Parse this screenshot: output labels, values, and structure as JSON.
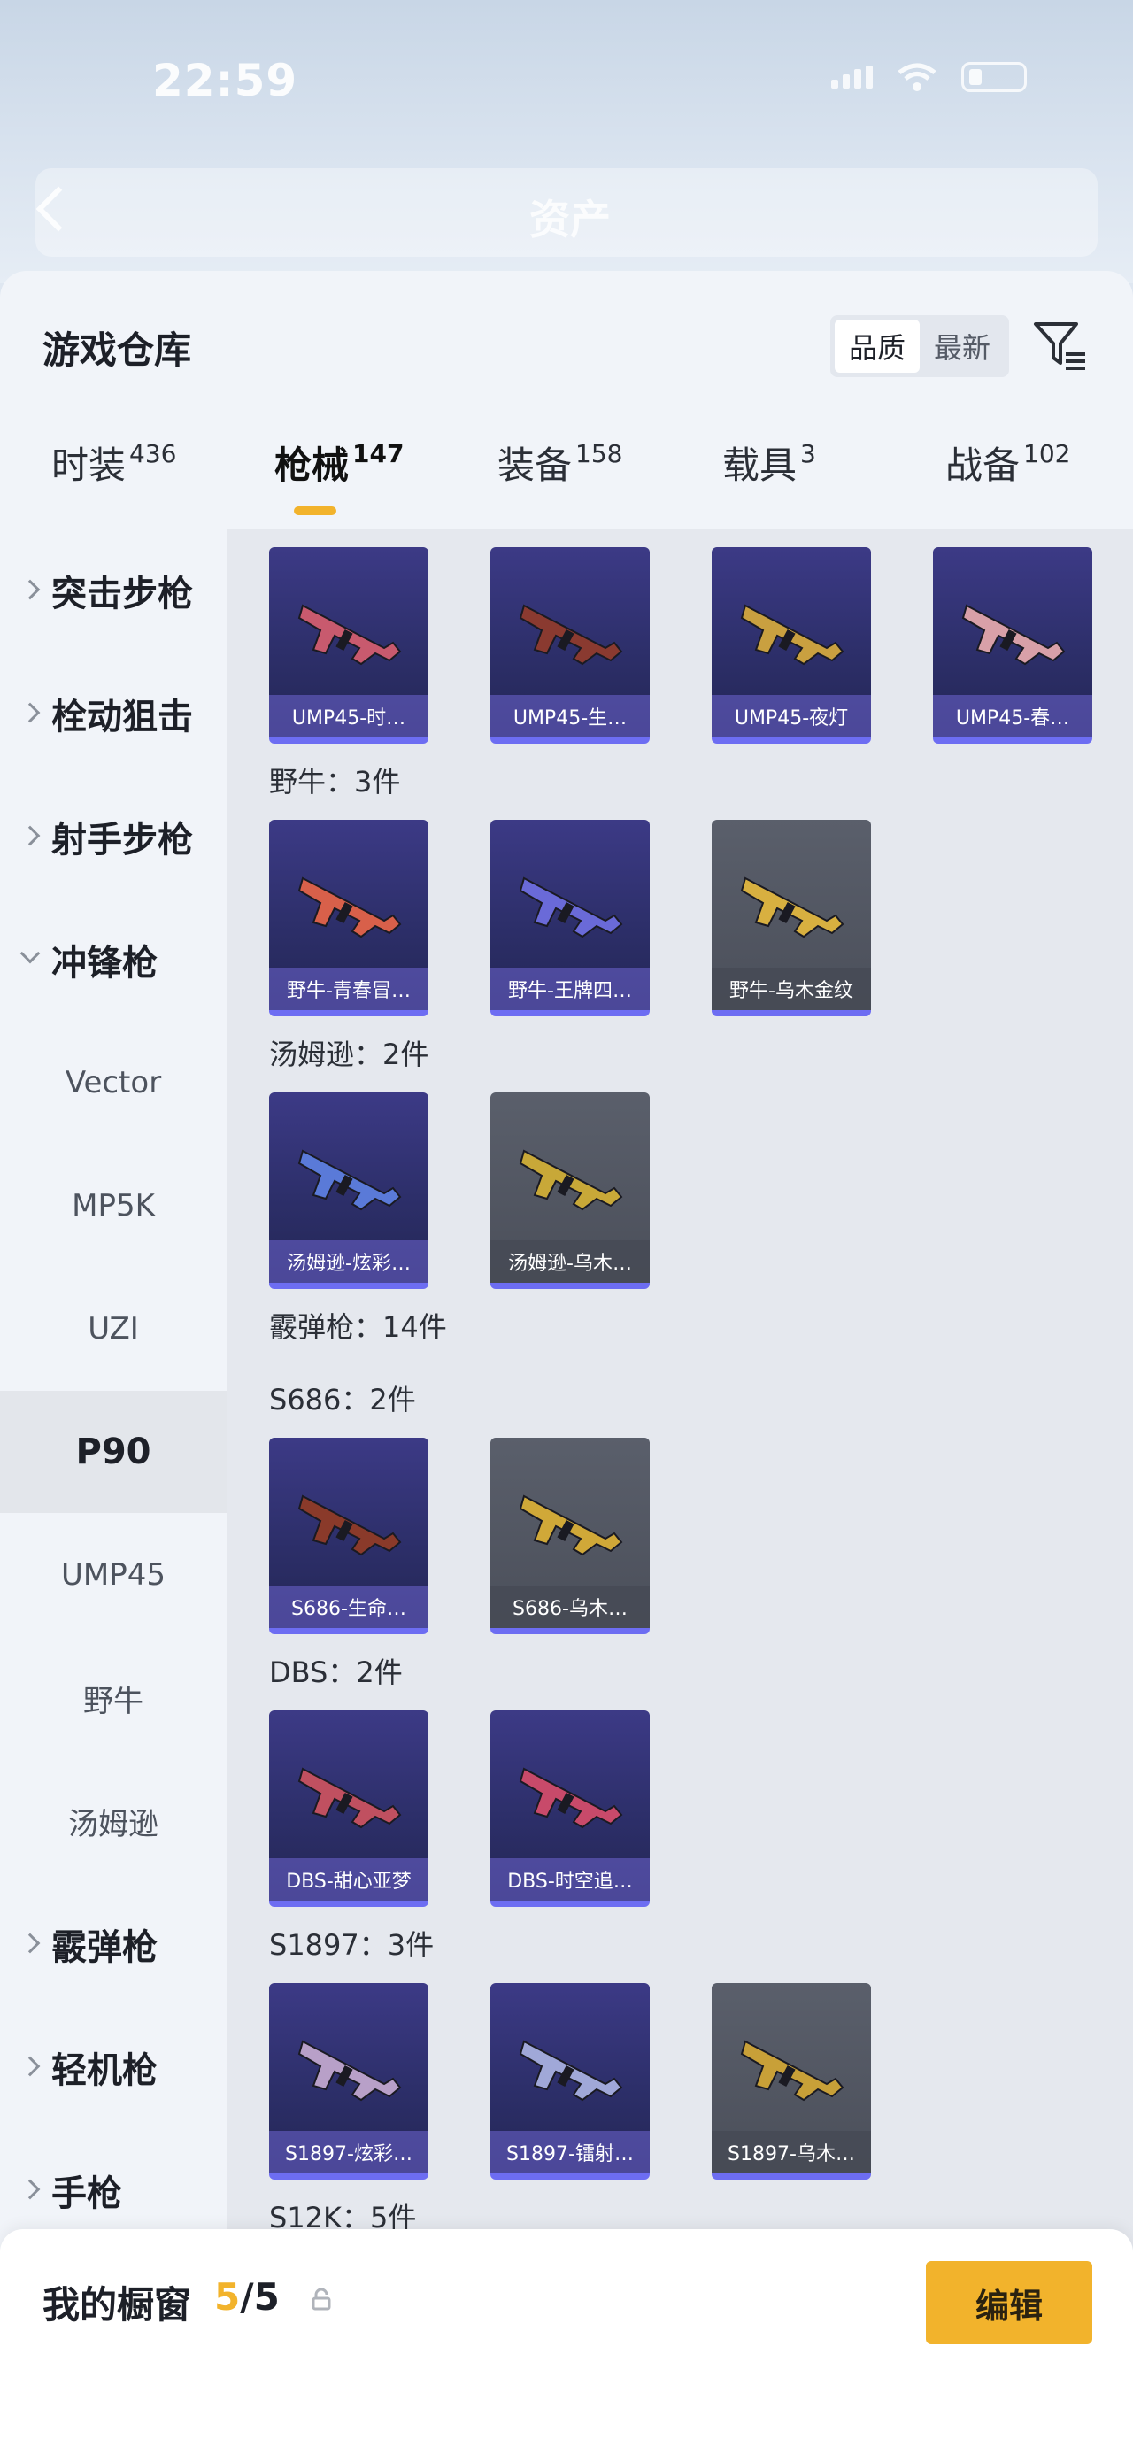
{
  "status_bar": {
    "time": "22:59"
  },
  "nav": {
    "title": "资产"
  },
  "sheet": {
    "title": "游戏仓库",
    "sort_options": [
      "品质",
      "最新"
    ],
    "tabs": [
      {
        "label": "时装",
        "count": "436"
      },
      {
        "label": "枪械",
        "count": "147"
      },
      {
        "label": "装备",
        "count": "158"
      },
      {
        "label": "载具",
        "count": "3"
      },
      {
        "label": "战备",
        "count": "102"
      }
    ]
  },
  "sidebar": {
    "items": [
      {
        "label": "突击步枪"
      },
      {
        "label": "栓动狙击"
      },
      {
        "label": "射手步枪"
      },
      {
        "label": "冲锋枪"
      },
      {
        "label": "Vector"
      },
      {
        "label": "MP5K"
      },
      {
        "label": "UZI"
      },
      {
        "label": "P90"
      },
      {
        "label": "UMP45"
      },
      {
        "label": "野牛"
      },
      {
        "label": "汤姆逊"
      },
      {
        "label": "霰弹枪"
      },
      {
        "label": "轻机枪"
      },
      {
        "label": "手枪"
      }
    ]
  },
  "content": {
    "groups": [
      {
        "title": "野牛：3件"
      },
      {
        "title": "汤姆逊：2件"
      },
      {
        "title": "霰弹枪：14件"
      },
      {
        "title": "S686：2件"
      },
      {
        "title": "DBS：2件"
      },
      {
        "title": "S1897：3件"
      },
      {
        "title": "S12K：5件"
      }
    ],
    "cards": [
      {
        "label": "UMP45-时…",
        "color": "#c85a6e"
      },
      {
        "label": "UMP45-生…",
        "color": "#8a3a30"
      },
      {
        "label": "UMP45-夜灯",
        "color": "#c9a040"
      },
      {
        "label": "UMP45-春…",
        "color": "#d8a0a8"
      },
      {
        "label": "野牛-青春冒…",
        "color": "#d8604a"
      },
      {
        "label": "野牛-王牌四…",
        "color": "#6a6ad8"
      },
      {
        "label": "野牛-乌木金纹",
        "color": "#d8b040"
      },
      {
        "label": "汤姆逊-炫彩…",
        "color": "#5a7ad8"
      },
      {
        "label": "汤姆逊-乌木…",
        "color": "#c8a838"
      },
      {
        "label": "S686-生命…",
        "color": "#8a3a2a"
      },
      {
        "label": "S686-乌木…",
        "color": "#d0a838"
      },
      {
        "label": "DBS-甜心亚梦",
        "color": "#c05060"
      },
      {
        "label": "DBS-时空追…",
        "color": "#c84a6a"
      },
      {
        "label": "S1897-炫彩…",
        "color": "#b8a0c8"
      },
      {
        "label": "S1897-镭射…",
        "color": "#a0a8d8"
      },
      {
        "label": "S1897-乌木…",
        "color": "#c8a038"
      }
    ]
  },
  "bottom": {
    "window_label": "我的橱窗",
    "current": "5",
    "total": "/5",
    "edit_label": "编辑"
  }
}
